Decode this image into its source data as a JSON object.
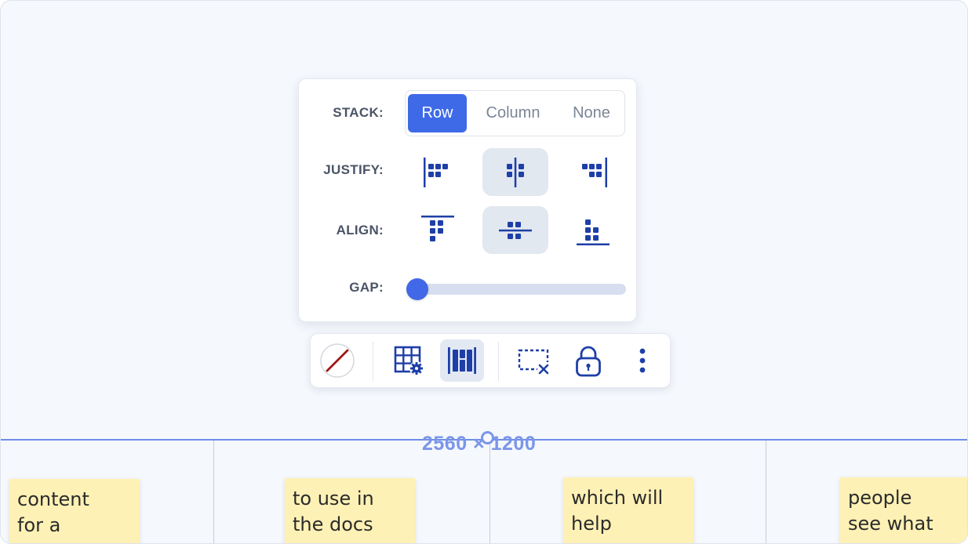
{
  "layout_panel": {
    "stack": {
      "label": "STACK:",
      "options": [
        "Row",
        "Column",
        "None"
      ],
      "selected": "Row"
    },
    "justify": {
      "label": "JUSTIFY:",
      "options": [
        "justify-start-icon",
        "justify-center-icon",
        "justify-end-icon"
      ],
      "selected": "justify-center-icon"
    },
    "align": {
      "label": "ALIGN:",
      "options": [
        "align-top-icon",
        "align-middle-icon",
        "align-bottom-icon"
      ],
      "selected": "align-middle-icon"
    },
    "gap": {
      "label": "GAP:",
      "value": 0
    }
  },
  "toolbar": {
    "items": [
      "no-fill-icon",
      "grid-settings-icon",
      "stack-layout-icon",
      "remove-frame-icon",
      "lock-icon",
      "more-options-icon"
    ],
    "selected": "stack-layout-icon"
  },
  "frame": {
    "dimensions": "2560 × 1200"
  },
  "sticky_notes": [
    {
      "lines": [
        "content",
        "for a"
      ]
    },
    {
      "lines": [
        "to use in",
        "the docs"
      ]
    },
    {
      "lines": [
        "which will",
        "help"
      ]
    },
    {
      "lines": [
        "people",
        "see what"
      ]
    }
  ],
  "colors": {
    "accent": "#3e6ae8",
    "icon": "#1e3fa8",
    "note": "#fef1b5",
    "frame": "#6f8de6"
  }
}
